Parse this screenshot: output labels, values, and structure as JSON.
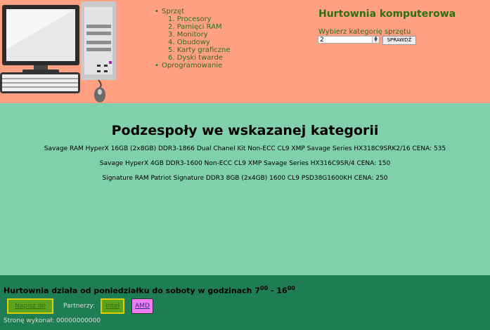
{
  "nav": {
    "hardware": "Sprzęt",
    "items": [
      "1. Procesory",
      "2. Pamięci RAM",
      "3. Monitory",
      "4. Obudowy",
      "5. Karty graficzne",
      "6. Dyski twarde"
    ],
    "software": "Oprogramowanie"
  },
  "header": {
    "title": "Hurtownia komputerowa",
    "category_label": "Wybierz kategorię sprzętu",
    "category_value": "2",
    "button": "SPRAWDŹ"
  },
  "main": {
    "heading": "Podzespoły we wskazanej kategorii",
    "results": [
      "Savage RAM HyperX 16GB (2x8GB) DDR3-1866 Dual Chanel Kit Non-ECC CL9 XMP Savage Series HX318C9SRK2/16 CENA: 535",
      "Savage HyperX 4GB DDR3-1600 Non-ECC CL9 XMP Savage Series HX316C9SR/4 CENA: 150",
      "Signature RAM Patriot Signature DDR3 8GB (2x4GB) 1600 CL9 PSD38G1600KH CENA: 250"
    ]
  },
  "footer": {
    "hours_text": "Hurtownia działa od poniedziałku do soboty w godzinach 7",
    "hours_from_sup": "00",
    "hours_sep": " - 16",
    "hours_to_sup": "00",
    "mail_link": "Napisz do nas",
    "partners_label": "Partnerzy:",
    "intel_link": "Intel",
    "amd_link": "AMD",
    "author": "Stronę wykonał: 00000000000"
  },
  "colors": {
    "header_bg": "#fea081",
    "main_bg": "#80cfad",
    "footer_bg": "#1e7d55",
    "accent_green": "#2c7011"
  }
}
